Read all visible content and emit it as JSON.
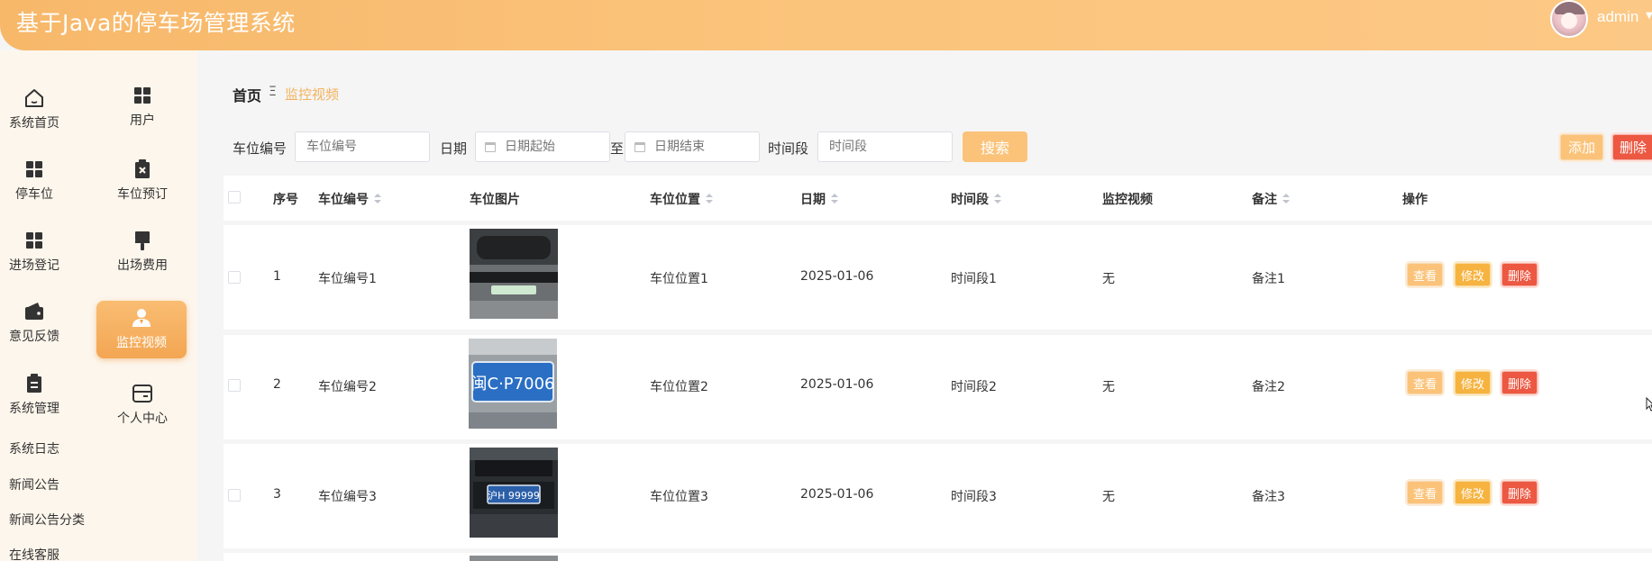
{
  "app": {
    "title": "基于Java的停车场管理系统"
  },
  "user": {
    "name": "admin"
  },
  "sidebar": {
    "items": [
      {
        "label": "系统首页",
        "icon": "home-icon"
      },
      {
        "label": "用户",
        "icon": "grid-icon"
      },
      {
        "label": "停车位",
        "icon": "grid-icon"
      },
      {
        "label": "车位预订",
        "icon": "clipboard-x-icon"
      },
      {
        "label": "进场登记",
        "icon": "grid-icon"
      },
      {
        "label": "出场费用",
        "icon": "brush-icon"
      },
      {
        "label": "意见反馈",
        "icon": "wallet-icon"
      },
      {
        "label": "监控视频",
        "icon": "user-icon",
        "active": true
      },
      {
        "label": "系统管理",
        "icon": "clipboard-icon"
      },
      {
        "label": "个人中心",
        "icon": "card-icon"
      }
    ],
    "sub_items": [
      "系统日志",
      "新闻公告",
      "新闻公告分类",
      "在线客服"
    ]
  },
  "breadcrumb": {
    "home": "首页",
    "separator": "Ξ",
    "current": "监控视频"
  },
  "search": {
    "spot_label": "车位编号",
    "spot_placeholder": "车位编号",
    "date_label": "日期",
    "date_start_placeholder": "日期起始",
    "date_to": "至",
    "date_end_placeholder": "日期结束",
    "period_label": "时间段",
    "period_placeholder": "时间段",
    "search_button": "搜索"
  },
  "toolbar": {
    "add_button": "添加",
    "delete_button": "删除"
  },
  "table": {
    "headers": [
      "序号",
      "车位编号",
      "车位图片",
      "车位位置",
      "日期",
      "时间段",
      "监控视频",
      "备注",
      "操作"
    ],
    "rows": [
      {
        "index": "1",
        "spot_no": "车位编号1",
        "location": "车位位置1",
        "date": "2025-01-06",
        "period": "时间段1",
        "video": "无",
        "remark": "备注1",
        "plate": ""
      },
      {
        "index": "2",
        "spot_no": "车位编号2",
        "location": "车位位置2",
        "date": "2025-01-06",
        "period": "时间段2",
        "video": "无",
        "remark": "备注2",
        "plate": "闽C·P7006"
      },
      {
        "index": "3",
        "spot_no": "车位编号3",
        "location": "车位位置3",
        "date": "2025-01-06",
        "period": "时间段3",
        "video": "无",
        "remark": "备注3",
        "plate": "沪H 99999"
      }
    ],
    "actions": {
      "view": "查看",
      "edit": "修改",
      "delete": "删除"
    }
  },
  "colors": {
    "accent": "#f7b86a",
    "danger": "#ec5842",
    "warning": "#f6b340"
  }
}
